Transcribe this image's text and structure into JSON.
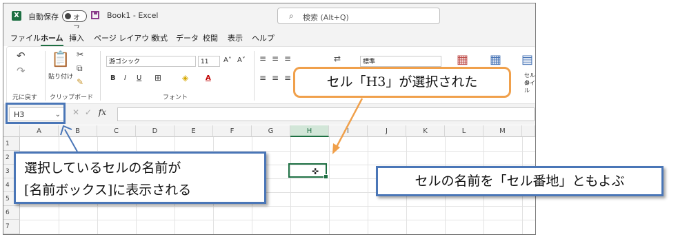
{
  "titlebar": {
    "app_logo": "X",
    "autosave_label": "自動保存",
    "autosave_state": "オフ",
    "doc_title": "Book1  -  Excel",
    "search_placeholder": "検索 (Alt+Q)"
  },
  "menu": {
    "tabs": [
      "ファイル",
      "ホーム",
      "挿入",
      "ページ レイアウト",
      "数式",
      "データ",
      "校閲",
      "表示",
      "ヘルプ"
    ],
    "active": "ホーム"
  },
  "ribbon": {
    "undo_group_label": "元に戻す",
    "clipboard_label": "クリップボード",
    "paste_label": "貼り付け",
    "font_group_label": "フォント",
    "font_name": "游ゴシック",
    "font_size": "11",
    "bold": "B",
    "italic": "I",
    "underline": "U",
    "number_format": "標準",
    "cell_style_label_1": "セルの",
    "cell_style_label_2": "タイル"
  },
  "formula_bar": {
    "name_box": "H3",
    "fx": "fx",
    "formula": ""
  },
  "grid": {
    "columns": [
      "A",
      "B",
      "C",
      "D",
      "E",
      "F",
      "G",
      "H",
      "I",
      "J",
      "K",
      "L",
      "M"
    ],
    "rows": [
      "1",
      "2",
      "3",
      "4",
      "5",
      "6",
      "7"
    ],
    "selected_column": "H",
    "selected_cell": "H3"
  },
  "annotations": {
    "selected_note": "セル「H3」が選択された",
    "namebox_note_line1": "選択しているセルの名前が",
    "namebox_note_line2": "[名前ボックス]に表示される",
    "address_note": "セルの名前を「セル番地」ともよぶ"
  },
  "colors": {
    "excel_green": "#1d6f42",
    "orange_callout": "#f0a04b",
    "blue_callout": "#4a76b7"
  }
}
